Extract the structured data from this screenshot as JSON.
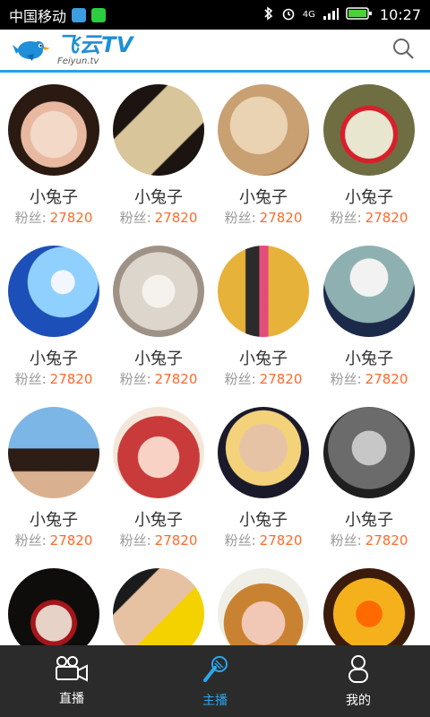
{
  "status_bar": {
    "carrier": "中国移动",
    "network": "4G",
    "time": "10:27",
    "colors": {
      "msg_icon": "#3c9ee0",
      "wechat_icon": "#2ecc40",
      "battery": "#4cd137"
    }
  },
  "header": {
    "logo_title": "飞云TV",
    "logo_subtitle": "Feiyun.tv",
    "accent_color": "#22a3e4"
  },
  "anchors": [
    {
      "name": "小兔子",
      "fans_label": "粉丝:",
      "fans_count": "27820",
      "theme": "woman portrait",
      "colors": [
        "#f2d9c8",
        "#2a1a12",
        "#e9b8a0"
      ]
    },
    {
      "name": "小兔子",
      "fans_label": "粉丝:",
      "fans_count": "27820",
      "theme": "retro woman",
      "colors": [
        "#1b1410",
        "#d9c59a",
        "#c03030"
      ]
    },
    {
      "name": "小兔子",
      "fans_label": "粉丝:",
      "fans_count": "27820",
      "theme": "painted face",
      "colors": [
        "#e9d3b3",
        "#c9a072",
        "#8f5b3a"
      ]
    },
    {
      "name": "小兔子",
      "fans_label": "粉丝:",
      "fans_count": "27820",
      "theme": "clown mask",
      "colors": [
        "#6f6e43",
        "#e8e6cf",
        "#d81f2a"
      ]
    },
    {
      "name": "小兔子",
      "fans_label": "粉丝:",
      "fans_count": "27820",
      "theme": "anime blue",
      "colors": [
        "#1d4fb8",
        "#8fd0ff",
        "#f2f7ff"
      ]
    },
    {
      "name": "小兔子",
      "fans_label": "粉丝:",
      "fans_count": "27820",
      "theme": "white cat",
      "colors": [
        "#ddd6cc",
        "#9e9286",
        "#f5f2ee"
      ]
    },
    {
      "name": "小兔子",
      "fans_label": "粉丝:",
      "fans_count": "27820",
      "theme": "graffiti",
      "colors": [
        "#e7b23a",
        "#2b2b2b",
        "#e34d79"
      ]
    },
    {
      "name": "小兔子",
      "fans_label": "粉丝:",
      "fans_count": "27820",
      "theme": "eagle suit",
      "colors": [
        "#8fb0b0",
        "#f2f2f2",
        "#1c2a4a"
      ]
    },
    {
      "name": "小兔子",
      "fans_label": "粉丝:",
      "fans_count": "27820",
      "theme": "woman lake",
      "colors": [
        "#7bb6e6",
        "#2c1d16",
        "#d9b190"
      ]
    },
    {
      "name": "小兔子",
      "fans_label": "粉丝:",
      "fans_count": "27820",
      "theme": "anime red hair",
      "colors": [
        "#f4e7da",
        "#c93a3a",
        "#f8d2c5"
      ]
    },
    {
      "name": "小兔子",
      "fans_label": "粉丝:",
      "fans_count": "27820",
      "theme": "doll",
      "colors": [
        "#1b1a2a",
        "#e7c3a6",
        "#f3d27a"
      ]
    },
    {
      "name": "小兔子",
      "fans_label": "粉丝:",
      "fans_count": "27820",
      "theme": "bearded man",
      "colors": [
        "#1f1f1f",
        "#6b6b6b",
        "#c7c7c7"
      ]
    },
    {
      "name": "",
      "fans_label": "",
      "fans_count": "",
      "theme": "dark hair",
      "colors": [
        "#0f0c0c",
        "#e7d2c7",
        "#a5161b"
      ]
    },
    {
      "name": "",
      "fans_label": "",
      "fans_count": "",
      "theme": "yellow illustration",
      "colors": [
        "#f4d200",
        "#1b1b1b",
        "#e7c2a2"
      ]
    },
    {
      "name": "",
      "fans_label": "",
      "fans_count": "",
      "theme": "orange hair",
      "colors": [
        "#f0efe7",
        "#c98232",
        "#f1c7b6"
      ]
    },
    {
      "name": "",
      "fans_label": "",
      "fans_count": "",
      "theme": "yellow monster",
      "colors": [
        "#3b1b0c",
        "#f5b11b",
        "#ff6a00"
      ]
    }
  ],
  "bottom_nav": [
    {
      "label": "直播",
      "icon": "video-camera-icon",
      "active": false
    },
    {
      "label": "主播",
      "icon": "microphone-icon",
      "active": true
    },
    {
      "label": "我的",
      "icon": "user-icon",
      "active": false
    }
  ]
}
